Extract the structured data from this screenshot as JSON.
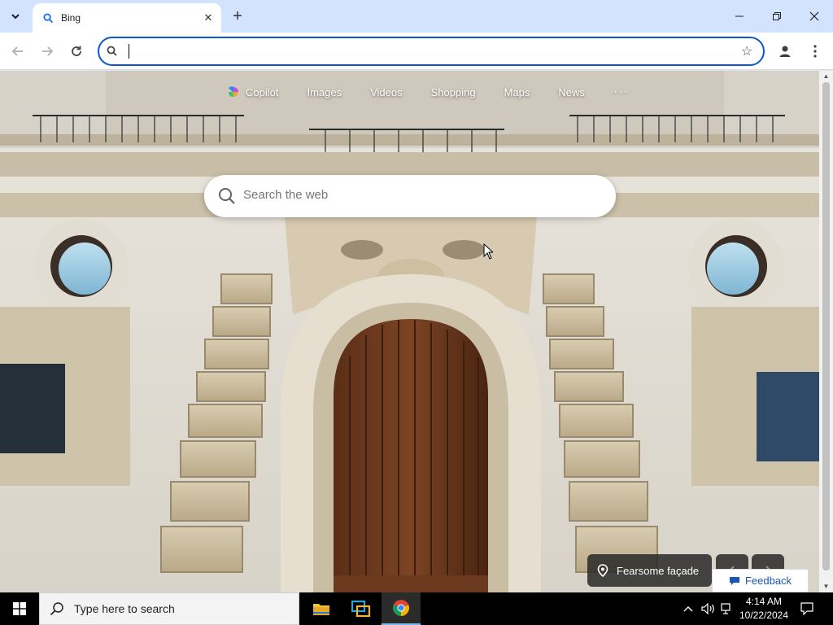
{
  "browser": {
    "tab": {
      "title": "Bing"
    },
    "new_tab_label": "+",
    "omnibox": {
      "value": "",
      "placeholder": ""
    }
  },
  "bing": {
    "nav": [
      "Copilot",
      "Images",
      "Videos",
      "Shopping",
      "Maps",
      "News"
    ],
    "more": "···",
    "search_placeholder": "Search the web",
    "image_title": "Fearsome façade",
    "feedback": "Feedback"
  },
  "taskbar": {
    "search_placeholder": "Type here to search",
    "time": "4:14 AM",
    "date": "10/22/2024"
  },
  "colors": {
    "tabstrip": "#d3e3fd",
    "omnibox_border": "#0b57d0",
    "feedback_text": "#1a57b4",
    "taskbar": "#000000"
  }
}
